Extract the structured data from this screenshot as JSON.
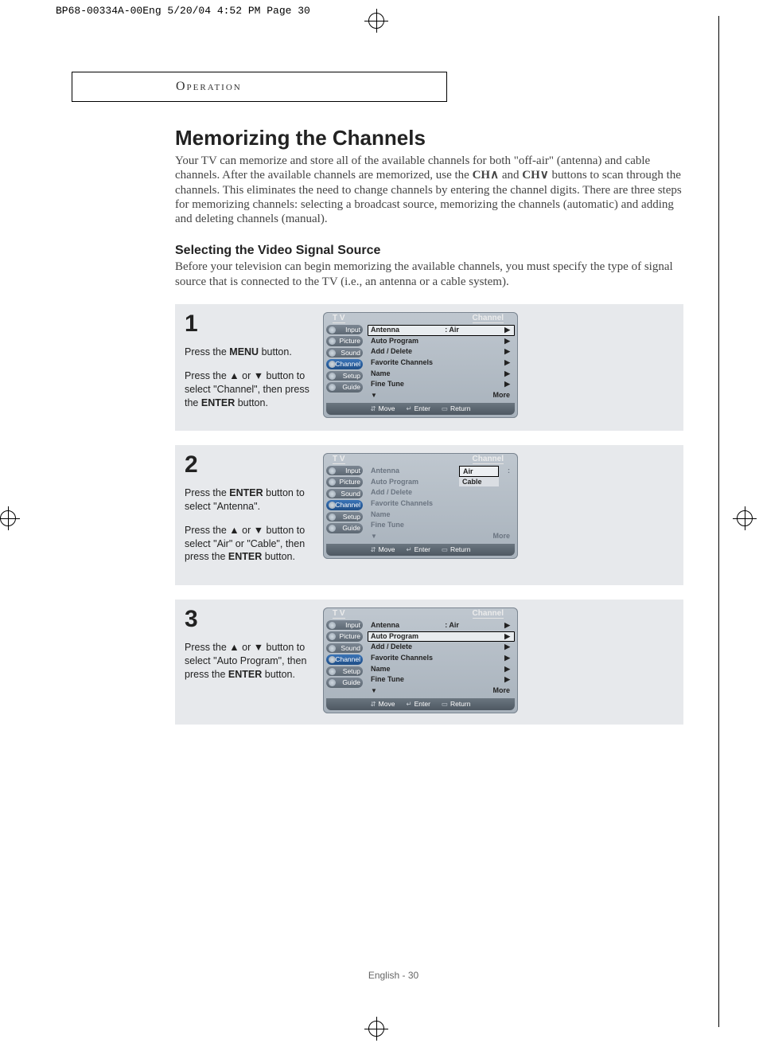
{
  "print_header": "BP68-00334A-00Eng  5/20/04  4:52 PM  Page 30",
  "section_tab": "Operation",
  "title": "Memorizing the Channels",
  "intro_before": "Your TV can memorize and store all of the available channels for both \"off-air\" (antenna) and cable channels. After the available channels are memorized, use the ",
  "ch_up": "CH",
  "and": " and ",
  "ch_dn": "CH",
  "intro_after": " buttons to scan through the channels. This eliminates the need to change channels by entering the channel digits. There are three steps for memorizing channels: selecting a broadcast source, memorizing the channels (automatic) and adding and deleting channels (manual).",
  "subtitle": "Selecting the Video Signal Source",
  "sub_intro": "Before your television can begin memorizing the available channels, you must specify the type of signal source that is connected to the TV (i.e., an antenna or a cable system).",
  "steps": {
    "s1": {
      "num": "1",
      "p1a": "Press the ",
      "p1b": "MENU",
      "p1c": " button.",
      "p2a": "Press the ▲ or ▼ button to select \"Channel\", then press the ",
      "p2b": "ENTER",
      "p2c": " button."
    },
    "s2": {
      "num": "2",
      "p1a": "Press the ",
      "p1b": "ENTER",
      "p1c": " button to select \"Antenna\".",
      "p2a": "Press the ▲ or ▼ button to select \"Air\" or \"Cable\", then press the ",
      "p2b": "ENTER",
      "p2c": " button."
    },
    "s3": {
      "num": "3",
      "p1a": "Press the ▲ or ▼ button to select \"Auto Program\", then press the ",
      "p1b": "ENTER",
      "p1c": " button."
    }
  },
  "osd": {
    "title_left": "T V",
    "title_right": "Channel",
    "side": {
      "input": "Input",
      "picture": "Picture",
      "sound": "Sound",
      "channel": "Channel",
      "setup": "Setup",
      "guide": "Guide"
    },
    "menu": {
      "antenna": "Antenna",
      "antenna_val": ":   Air",
      "auto_program": "Auto Program",
      "add_delete": "Add / Delete",
      "fav": "Favorite Channels",
      "name": "Name",
      "fine": "Fine Tune",
      "more": "More"
    },
    "dropdown": {
      "air": "Air",
      "cable": "Cable"
    },
    "footer": {
      "move": "Move",
      "enter": "Enter",
      "ret": "Return"
    }
  },
  "page_footer": "English - 30"
}
